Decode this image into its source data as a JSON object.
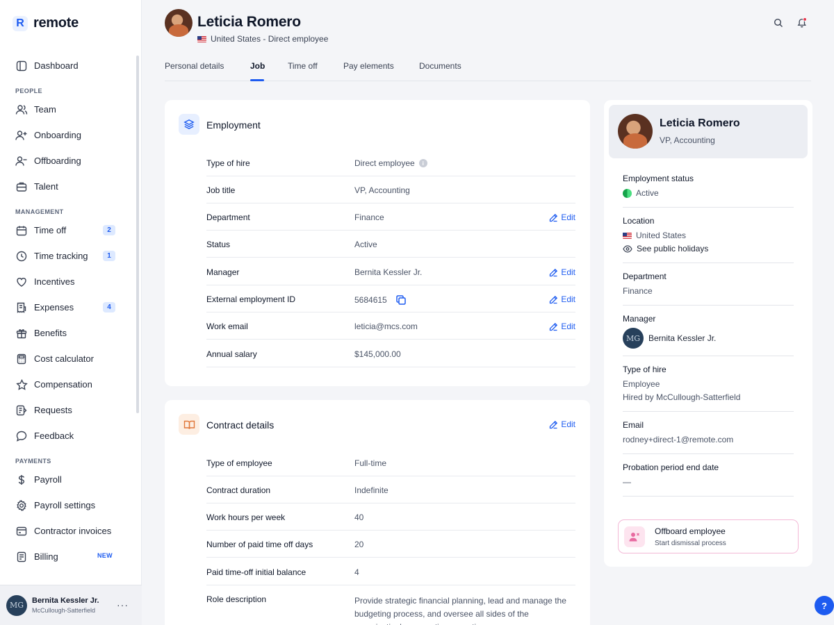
{
  "brand": {
    "logo_letter": "R",
    "name": "remote"
  },
  "sidebar": {
    "items": [
      {
        "type": "item",
        "label": "Dashboard",
        "icon": "dashboard-icon"
      },
      {
        "type": "section",
        "label": "PEOPLE"
      },
      {
        "type": "item",
        "label": "Team",
        "icon": "team-icon"
      },
      {
        "type": "item",
        "label": "Onboarding",
        "icon": "onboarding-icon"
      },
      {
        "type": "item",
        "label": "Offboarding",
        "icon": "offboarding-icon"
      },
      {
        "type": "item",
        "label": "Talent",
        "icon": "talent-icon"
      },
      {
        "type": "section",
        "label": "MANAGEMENT"
      },
      {
        "type": "item",
        "label": "Time off",
        "icon": "time-off-icon",
        "badge": "2"
      },
      {
        "type": "item",
        "label": "Time tracking",
        "icon": "clock-icon",
        "badge": "1"
      },
      {
        "type": "item",
        "label": "Incentives",
        "icon": "heart-icon"
      },
      {
        "type": "item",
        "label": "Expenses",
        "icon": "receipt-icon",
        "badge": "4"
      },
      {
        "type": "item",
        "label": "Benefits",
        "icon": "gift-icon"
      },
      {
        "type": "item",
        "label": "Cost calculator",
        "icon": "calculator-icon"
      },
      {
        "type": "item",
        "label": "Compensation",
        "icon": "star-icon"
      },
      {
        "type": "item",
        "label": "Requests",
        "icon": "requests-icon"
      },
      {
        "type": "item",
        "label": "Feedback",
        "icon": "chat-bubble-icon"
      },
      {
        "type": "section",
        "label": "PAYMENTS"
      },
      {
        "type": "item",
        "label": "Payroll",
        "icon": "dollar-icon"
      },
      {
        "type": "item",
        "label": "Payroll settings",
        "icon": "gear-icon"
      },
      {
        "type": "item",
        "label": "Contractor invoices",
        "icon": "invoice-icon"
      },
      {
        "type": "item",
        "label": "Billing",
        "icon": "billing-icon",
        "new": "NEW"
      }
    ],
    "footer": {
      "initials": "MG",
      "name": "Bernita Kessler Jr.",
      "company": "McCullough-Satterfield",
      "more": "···"
    }
  },
  "header": {
    "name": "Leticia Romero",
    "subtitle": "United States - Direct employee"
  },
  "tabs": [
    "Personal details",
    "Job",
    "Time off",
    "Pay elements",
    "Documents"
  ],
  "active_tab": "Job",
  "employment": {
    "title": "Employment",
    "edit_label": "Edit",
    "rows": [
      {
        "label": "Type of hire",
        "value": "Direct employee",
        "info": true,
        "edit": false
      },
      {
        "label": "Job title",
        "value": "VP, Accounting",
        "edit": false
      },
      {
        "label": "Department",
        "value": "Finance",
        "edit": true
      },
      {
        "label": "Status",
        "value": "Active",
        "edit": false
      },
      {
        "label": "Manager",
        "value": "Bernita Kessler Jr.",
        "edit": true
      },
      {
        "label": "External employment ID",
        "value": "5684615",
        "copy": true,
        "edit": true
      },
      {
        "label": "Work email",
        "value": "leticia@mcs.com",
        "edit": true
      },
      {
        "label": "Annual salary",
        "value": "$145,000.00",
        "edit": false
      }
    ]
  },
  "contract": {
    "title": "Contract details",
    "edit_label": "Edit",
    "rows": [
      {
        "label": "Type of employee",
        "value": "Full-time"
      },
      {
        "label": "Contract duration",
        "value": "Indefinite"
      },
      {
        "label": "Work hours per week",
        "value": "40"
      },
      {
        "label": "Number of paid time off days",
        "value": "20"
      },
      {
        "label": "Paid time-off initial balance",
        "value": "4"
      }
    ],
    "role_label": "Role description",
    "role_value": "Provide strategic financial planning, lead and manage the budgeting process, and oversee all sides of the organization's accounting operations."
  },
  "profile": {
    "name": "Leticia Romero",
    "title": "VP, Accounting",
    "employment_status_label": "Employment status",
    "employment_status": "Active",
    "location_label": "Location",
    "location": "United States",
    "holidays_link": "See public holidays",
    "department_label": "Department",
    "department": "Finance",
    "manager_label": "Manager",
    "manager_initials": "MG",
    "manager": "Bernita Kessler Jr.",
    "type_of_hire_label": "Type of hire",
    "type_of_hire": "Employee",
    "hired_by": "Hired by McCullough-Satterfield",
    "email_label": "Email",
    "email": "rodney+direct-1@remote.com",
    "probation_label": "Probation period end date",
    "probation": "—"
  },
  "offboard": {
    "title": "Offboard employee",
    "subtitle": "Start dismissal process"
  },
  "help": {
    "label": "?"
  },
  "colors": {
    "accent": "#1d5bf0",
    "active_status": "#16a34a",
    "offboard_border": "#f3b8d6"
  }
}
